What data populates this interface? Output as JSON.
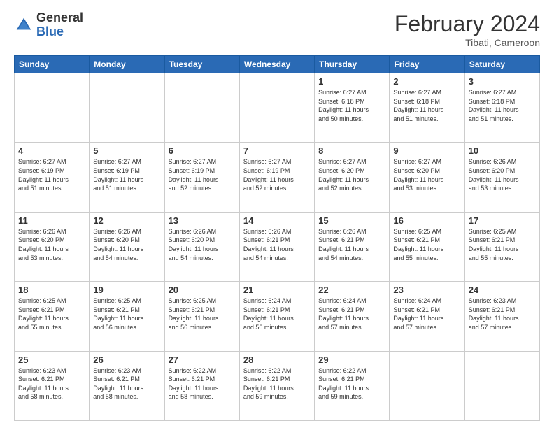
{
  "header": {
    "logo_general": "General",
    "logo_blue": "Blue",
    "title": "February 2024",
    "location": "Tibati, Cameroon"
  },
  "days_of_week": [
    "Sunday",
    "Monday",
    "Tuesday",
    "Wednesday",
    "Thursday",
    "Friday",
    "Saturday"
  ],
  "weeks": [
    [
      {
        "num": "",
        "info": ""
      },
      {
        "num": "",
        "info": ""
      },
      {
        "num": "",
        "info": ""
      },
      {
        "num": "",
        "info": ""
      },
      {
        "num": "1",
        "info": "Sunrise: 6:27 AM\nSunset: 6:18 PM\nDaylight: 11 hours\nand 50 minutes."
      },
      {
        "num": "2",
        "info": "Sunrise: 6:27 AM\nSunset: 6:18 PM\nDaylight: 11 hours\nand 51 minutes."
      },
      {
        "num": "3",
        "info": "Sunrise: 6:27 AM\nSunset: 6:18 PM\nDaylight: 11 hours\nand 51 minutes."
      }
    ],
    [
      {
        "num": "4",
        "info": "Sunrise: 6:27 AM\nSunset: 6:19 PM\nDaylight: 11 hours\nand 51 minutes."
      },
      {
        "num": "5",
        "info": "Sunrise: 6:27 AM\nSunset: 6:19 PM\nDaylight: 11 hours\nand 51 minutes."
      },
      {
        "num": "6",
        "info": "Sunrise: 6:27 AM\nSunset: 6:19 PM\nDaylight: 11 hours\nand 52 minutes."
      },
      {
        "num": "7",
        "info": "Sunrise: 6:27 AM\nSunset: 6:19 PM\nDaylight: 11 hours\nand 52 minutes."
      },
      {
        "num": "8",
        "info": "Sunrise: 6:27 AM\nSunset: 6:20 PM\nDaylight: 11 hours\nand 52 minutes."
      },
      {
        "num": "9",
        "info": "Sunrise: 6:27 AM\nSunset: 6:20 PM\nDaylight: 11 hours\nand 53 minutes."
      },
      {
        "num": "10",
        "info": "Sunrise: 6:26 AM\nSunset: 6:20 PM\nDaylight: 11 hours\nand 53 minutes."
      }
    ],
    [
      {
        "num": "11",
        "info": "Sunrise: 6:26 AM\nSunset: 6:20 PM\nDaylight: 11 hours\nand 53 minutes."
      },
      {
        "num": "12",
        "info": "Sunrise: 6:26 AM\nSunset: 6:20 PM\nDaylight: 11 hours\nand 54 minutes."
      },
      {
        "num": "13",
        "info": "Sunrise: 6:26 AM\nSunset: 6:20 PM\nDaylight: 11 hours\nand 54 minutes."
      },
      {
        "num": "14",
        "info": "Sunrise: 6:26 AM\nSunset: 6:21 PM\nDaylight: 11 hours\nand 54 minutes."
      },
      {
        "num": "15",
        "info": "Sunrise: 6:26 AM\nSunset: 6:21 PM\nDaylight: 11 hours\nand 54 minutes."
      },
      {
        "num": "16",
        "info": "Sunrise: 6:25 AM\nSunset: 6:21 PM\nDaylight: 11 hours\nand 55 minutes."
      },
      {
        "num": "17",
        "info": "Sunrise: 6:25 AM\nSunset: 6:21 PM\nDaylight: 11 hours\nand 55 minutes."
      }
    ],
    [
      {
        "num": "18",
        "info": "Sunrise: 6:25 AM\nSunset: 6:21 PM\nDaylight: 11 hours\nand 55 minutes."
      },
      {
        "num": "19",
        "info": "Sunrise: 6:25 AM\nSunset: 6:21 PM\nDaylight: 11 hours\nand 56 minutes."
      },
      {
        "num": "20",
        "info": "Sunrise: 6:25 AM\nSunset: 6:21 PM\nDaylight: 11 hours\nand 56 minutes."
      },
      {
        "num": "21",
        "info": "Sunrise: 6:24 AM\nSunset: 6:21 PM\nDaylight: 11 hours\nand 56 minutes."
      },
      {
        "num": "22",
        "info": "Sunrise: 6:24 AM\nSunset: 6:21 PM\nDaylight: 11 hours\nand 57 minutes."
      },
      {
        "num": "23",
        "info": "Sunrise: 6:24 AM\nSunset: 6:21 PM\nDaylight: 11 hours\nand 57 minutes."
      },
      {
        "num": "24",
        "info": "Sunrise: 6:23 AM\nSunset: 6:21 PM\nDaylight: 11 hours\nand 57 minutes."
      }
    ],
    [
      {
        "num": "25",
        "info": "Sunrise: 6:23 AM\nSunset: 6:21 PM\nDaylight: 11 hours\nand 58 minutes."
      },
      {
        "num": "26",
        "info": "Sunrise: 6:23 AM\nSunset: 6:21 PM\nDaylight: 11 hours\nand 58 minutes."
      },
      {
        "num": "27",
        "info": "Sunrise: 6:22 AM\nSunset: 6:21 PM\nDaylight: 11 hours\nand 58 minutes."
      },
      {
        "num": "28",
        "info": "Sunrise: 6:22 AM\nSunset: 6:21 PM\nDaylight: 11 hours\nand 59 minutes."
      },
      {
        "num": "29",
        "info": "Sunrise: 6:22 AM\nSunset: 6:21 PM\nDaylight: 11 hours\nand 59 minutes."
      },
      {
        "num": "",
        "info": ""
      },
      {
        "num": "",
        "info": ""
      }
    ]
  ]
}
